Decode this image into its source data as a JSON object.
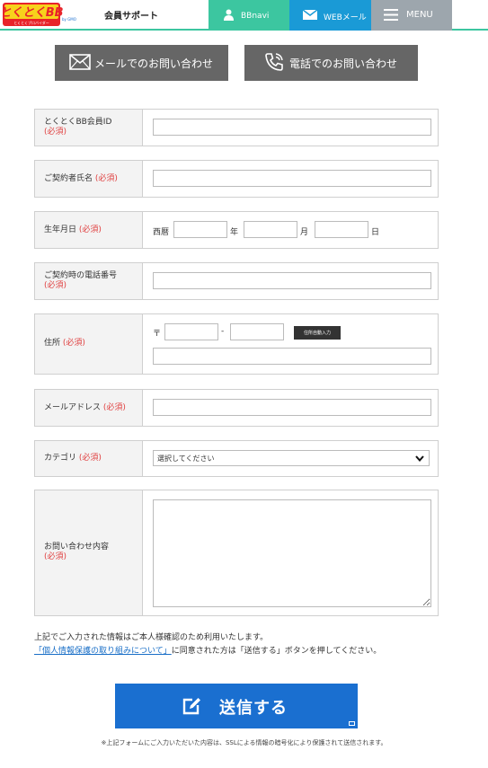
{
  "header": {
    "logo_text": "とくとくBB",
    "logo_sub": "by GMO",
    "logo_tagline": "とくとくプロバイダー",
    "support_title": "会員サポート",
    "bbnavi_label": "BBnavi",
    "web_mail_label": "WEBメール",
    "menu_label": "MENU"
  },
  "contact": {
    "mail_label": "メールでのお問い合わせ",
    "tel_label": "電話でのお問い合わせ"
  },
  "form": {
    "required": "(必須)",
    "member_id": {
      "label": "とくとくBB会員ID",
      "value": ""
    },
    "contract_name": {
      "label": "ご契約者氏名",
      "value": ""
    },
    "birth": {
      "label": "生年月日",
      "era": "西暦",
      "year_unit": "年",
      "month_unit": "月",
      "day_unit": "日"
    },
    "phone": {
      "label": "ご契約時の電話番号",
      "value": ""
    },
    "address": {
      "label": "住所",
      "zip_mark": "〒",
      "zip_dash": "-",
      "zip_button": "住所自動入力"
    },
    "email": {
      "label": "メールアドレス",
      "value": ""
    },
    "category": {
      "label": "カテゴリ",
      "selected": "選択してください"
    },
    "inquiry": {
      "label": "お問い合わせ内容",
      "value": ""
    }
  },
  "notes": {
    "line1": "上記でご入力された情報はご本人様確認のため利用いたします。",
    "privacy_link": "「個人情報保護の取り組みについて」",
    "line2_rest": "に同意された方は「送信する」ボタンを押してください。"
  },
  "submit_label": "送信する",
  "ssl_note": "※上記フォームにご入力いただいた内容は、SSLによる情報の暗号化により保護されて送信されます。",
  "colors": {
    "header_green": "#3cc6a0",
    "header_blue": "#1a9ad6",
    "header_gray": "#9da6ad",
    "contact_gray": "#666666",
    "submit_blue": "#1a6fd0",
    "required_red": "#e04040"
  }
}
